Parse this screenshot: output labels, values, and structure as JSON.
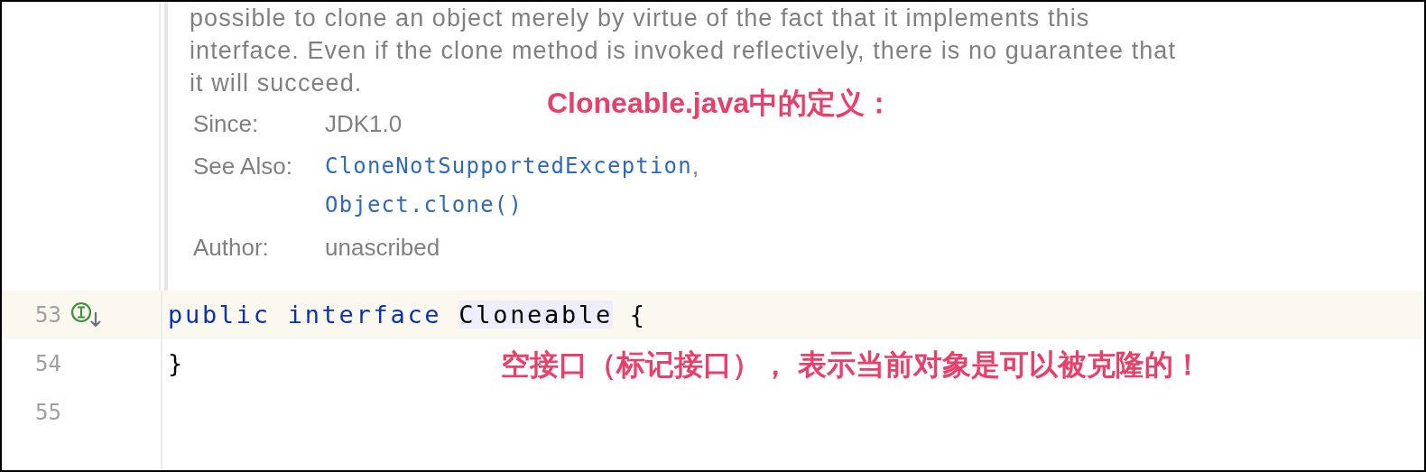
{
  "doc": {
    "paragraph_lines": [
      "possible to clone an object merely by virtue of the fact that it implements this",
      "interface. Even if the clone method is invoked reflectively, there is no guarantee that",
      "it will succeed."
    ],
    "note": "Cloneable.java中的定义：",
    "tags": [
      {
        "label": "Since:",
        "values": [
          {
            "text": "JDK1.0",
            "kind": "text"
          }
        ]
      },
      {
        "label": "See Also:",
        "values": [
          {
            "text": "CloneNotSupportedException",
            "kind": "link",
            "suffix": ","
          },
          {
            "text": "Object.clone()",
            "kind": "link"
          }
        ]
      },
      {
        "label": "Author:",
        "values": [
          {
            "text": "unascribed",
            "kind": "text"
          }
        ]
      }
    ]
  },
  "lines": [
    {
      "number": "53",
      "current": true,
      "marker": true,
      "tokens": [
        {
          "text": "public",
          "kind": "keyword"
        },
        {
          "text": "interface",
          "kind": "keyword"
        },
        {
          "text": "Cloneable",
          "kind": "highlighted"
        },
        {
          "text": "{",
          "kind": "plain"
        }
      ]
    },
    {
      "number": "54",
      "current": false,
      "marker": false,
      "tokens": [
        {
          "text": "}",
          "kind": "plain"
        }
      ],
      "note": "空接口（标记接口）， 表示当前对象是可以被克隆的！"
    },
    {
      "number": "55",
      "current": false,
      "marker": false
    }
  ]
}
